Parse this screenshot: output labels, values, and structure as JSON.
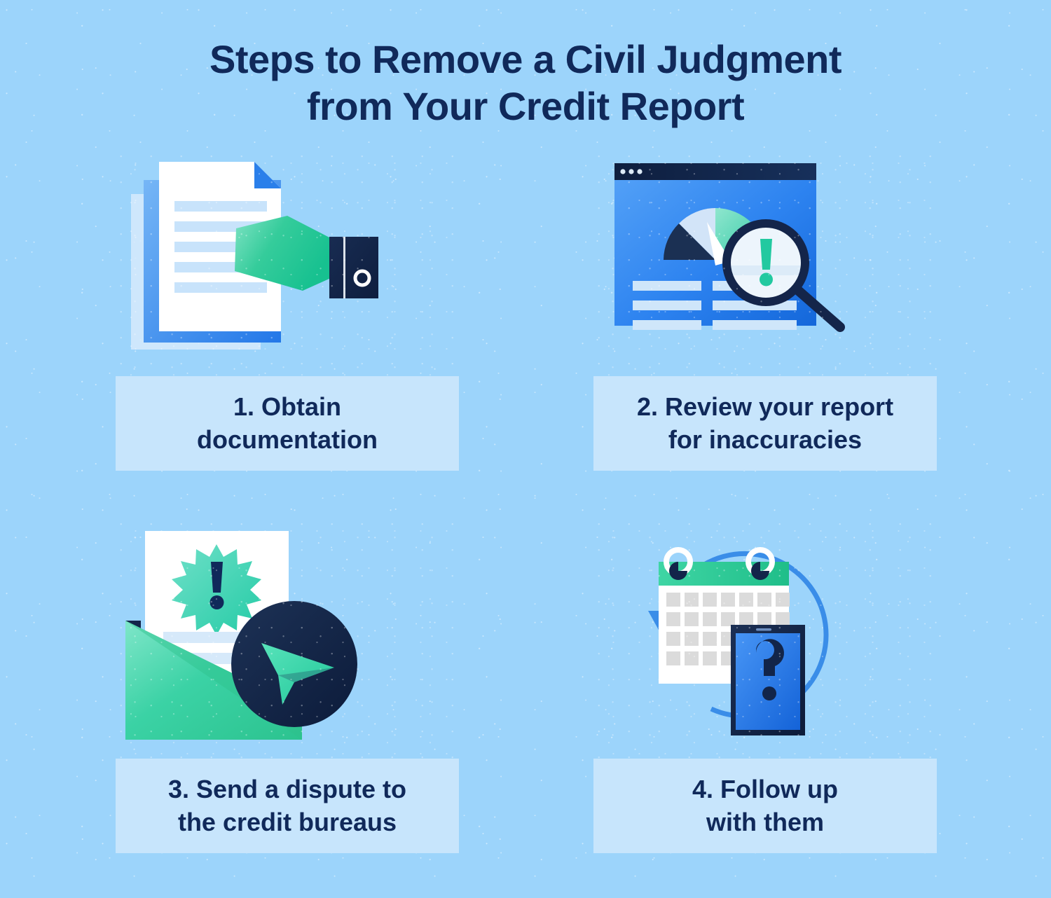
{
  "title": {
    "line1": "Steps to Remove a Civil Judgment",
    "line2": "from Your Credit Report"
  },
  "colors": {
    "background": "#9CD4FB",
    "caption_box": "#C7E5FC",
    "text_navy": "#10295A",
    "accent_blue": "#2B7BE4",
    "accent_blue_light": "#4A9BF0",
    "accent_green": "#2BC48E",
    "accent_teal": "#3ED6B0",
    "white": "#FFFFFF",
    "doc_line_blue": "#C3E1FA",
    "calendar_cell_gray": "#DCDCDC"
  },
  "steps": [
    {
      "id": "step-1",
      "number": "1.",
      "caption_line1": "1. Obtain",
      "caption_line2": "documentation",
      "icon_name": "document-handoff-illustration",
      "icon_parts": [
        "stacked-documents",
        "document-lines",
        "folded-corner",
        "reaching-hand",
        "shirt-cuff"
      ]
    },
    {
      "id": "step-2",
      "number": "2.",
      "caption_line1": "2. Review your report",
      "caption_line2": "for inaccuracies",
      "icon_name": "credit-report-review-illustration",
      "icon_parts": [
        "browser-window",
        "window-dots",
        "gauge-chart",
        "gauge-needle",
        "report-lines",
        "magnifying-glass",
        "exclamation-mark"
      ]
    },
    {
      "id": "step-3",
      "number": "3.",
      "caption_line1": "3. Send a dispute to",
      "caption_line2": "the credit bureaus",
      "icon_name": "dispute-letter-illustration",
      "icon_parts": [
        "letter-page",
        "starburst-alert",
        "exclamation-mark",
        "letter-lines",
        "envelope",
        "paper-plane-badge"
      ]
    },
    {
      "id": "step-4",
      "number": "4.",
      "caption_line1": "4. Follow up",
      "caption_line2": "with them",
      "icon_name": "follow-up-illustration",
      "icon_parts": [
        "circular-arrow",
        "calendar",
        "calendar-rings",
        "calendar-grid",
        "smartphone",
        "question-mark"
      ]
    }
  ]
}
